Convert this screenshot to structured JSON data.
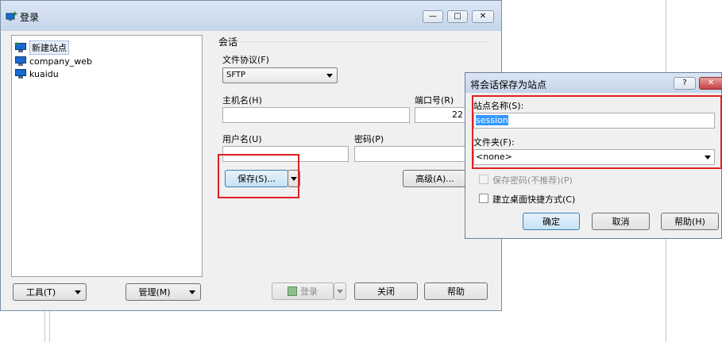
{
  "login_window": {
    "title": "登录",
    "sites": [
      {
        "label": "新建站点"
      },
      {
        "label": "company_web"
      },
      {
        "label": "kuaidu"
      }
    ],
    "tools_button": "工具(T)",
    "manage_button": "管理(M)",
    "login_button": "登录",
    "close_button": "关闭",
    "help_button": "帮助"
  },
  "session": {
    "group_label": "会话",
    "protocol_label": "文件协议(F)",
    "protocol_value": "SFTP",
    "host_label": "主机名(H)",
    "host_value": "",
    "port_label": "端口号(R)",
    "port_value": "22",
    "user_label": "用户名(U)",
    "user_value": "",
    "password_label": "密码(P)",
    "password_value": "",
    "save_button": "保存(S)...",
    "advanced_button": "高级(A)..."
  },
  "save_dialog": {
    "title": "将会话保存为站点",
    "help_icon": "?",
    "site_name_label": "站点名称(S):",
    "site_name_value": "session",
    "folder_label": "文件夹(F):",
    "folder_value": "<none>",
    "save_password_label": "保存密码(不推荐)(P)",
    "desktop_shortcut_label": "建立桌面快捷方式(C)",
    "ok_button": "确定",
    "cancel_button": "取消",
    "help_button": "帮助(H)"
  },
  "colors": {
    "highlight": "#e02020",
    "selection": "#3399ff"
  }
}
